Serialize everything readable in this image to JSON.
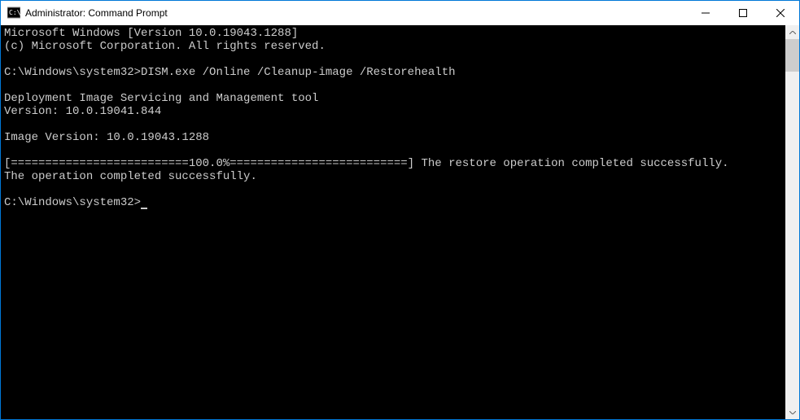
{
  "window": {
    "title": "Administrator: Command Prompt"
  },
  "console": {
    "line1": "Microsoft Windows [Version 10.0.19043.1288]",
    "line2": "(c) Microsoft Corporation. All rights reserved.",
    "blank1": "",
    "prompt1": "C:\\Windows\\system32>",
    "cmd1": "DISM.exe /Online /Cleanup-image /Restorehealth",
    "blank2": "",
    "tool1": "Deployment Image Servicing and Management tool",
    "tool2": "Version: 10.0.19041.844",
    "blank3": "",
    "imgver": "Image Version: 10.0.19043.1288",
    "blank4": "",
    "progress": "[==========================100.0%==========================] The restore operation completed successfully.",
    "opdone": "The operation completed successfully.",
    "blank5": "",
    "prompt2": "C:\\Windows\\system32>"
  }
}
